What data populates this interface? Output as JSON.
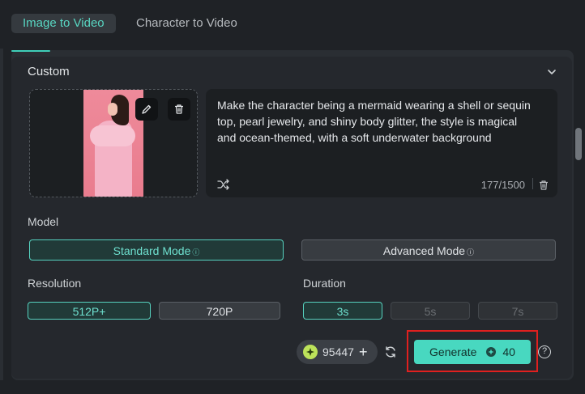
{
  "tabs": [
    {
      "label": "Image to Video"
    },
    {
      "label": "Character to Video"
    }
  ],
  "custom": {
    "title": "Custom",
    "prompt": "Make the character being a mermaid wearing a shell or sequin top, pearl jewelry, and shiny body glitter, the style is magical and ocean-themed, with a soft underwater background",
    "char_count": "177/1500"
  },
  "model": {
    "label": "Model",
    "standard": "Standard Mode",
    "advanced": "Advanced Mode",
    "selected": "Standard Mode"
  },
  "resolution": {
    "label": "Resolution",
    "options": [
      "512P+",
      "720P"
    ],
    "selected": "512P+"
  },
  "duration": {
    "label": "Duration",
    "options": [
      "3s",
      "5s",
      "7s"
    ],
    "selected": "3s"
  },
  "credits": {
    "value": "95447"
  },
  "generate": {
    "label": "Generate",
    "cost": "40"
  },
  "colors": {
    "accent": "#48d8c0",
    "highlight": "#e0201f",
    "credit_coin": "#bde35a"
  },
  "icons": [
    "edit-icon",
    "trash-icon",
    "chevron-down-icon",
    "shuffle-icon",
    "refresh-icon",
    "help-icon",
    "plus-icon",
    "coin-icon"
  ]
}
